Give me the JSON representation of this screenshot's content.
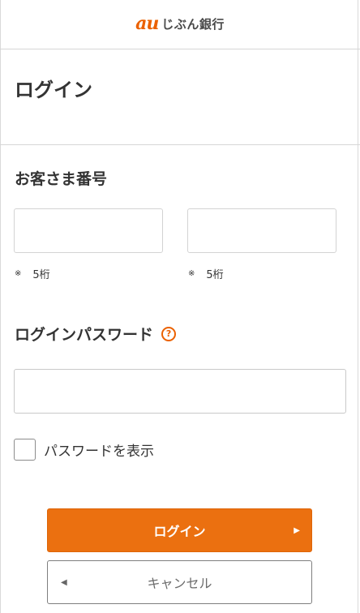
{
  "header": {
    "logo_mark": "au",
    "logo_text": "じぶん銀行"
  },
  "page": {
    "title": "ログイン"
  },
  "customer_number": {
    "label": "お客さま番号",
    "field1": {
      "value": "",
      "placeholder": ""
    },
    "field2": {
      "value": "",
      "placeholder": ""
    },
    "note_mark": "※",
    "note_text": "5桁"
  },
  "password": {
    "label": "ログインパスワード",
    "help_glyph": "?",
    "value": "",
    "placeholder": ""
  },
  "show_password": {
    "label": "パスワードを表示",
    "checked": false
  },
  "buttons": {
    "login_label": "ログイン",
    "login_arrow": "▶",
    "cancel_label": "キャンセル",
    "cancel_arrow": "◀"
  },
  "colors": {
    "accent": "#eb7010",
    "brand": "#eb6100"
  }
}
